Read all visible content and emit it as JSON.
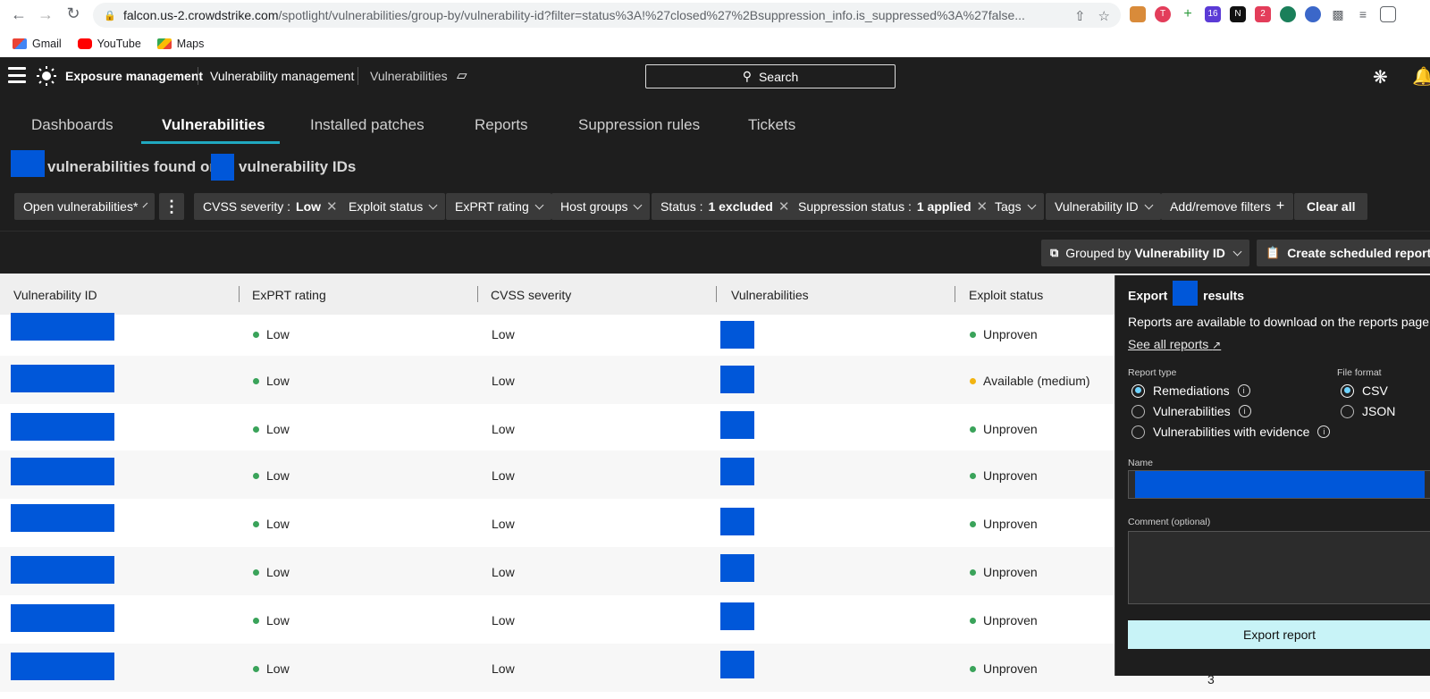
{
  "browser": {
    "url_host": "falcon.us-2.crowdstrike.com",
    "url_path": "/spotlight/vulnerabilities/group-by/vulnerability-id?filter=status%3A!%27closed%27%2Bsuppression_info.is_suppressed%3A%27false...",
    "bookmarks": [
      "Gmail",
      "YouTube",
      "Maps"
    ],
    "ext_badges": [
      "16",
      "2"
    ]
  },
  "header": {
    "product": "Exposure management",
    "section": "Vulnerability management",
    "page": "Vulnerabilities",
    "search_label": "Search"
  },
  "tabs": [
    "Dashboards",
    "Vulnerabilities",
    "Installed patches",
    "Reports",
    "Suppression rules",
    "Tickets"
  ],
  "active_tab": "Vulnerabilities",
  "summary": {
    "part1": "vulnerabilities found on",
    "part2": "vulnerability IDs"
  },
  "filters": {
    "open_vulns": "Open vulnerabilities*",
    "cvss_label": "CVSS severity :",
    "cvss_value": "Low",
    "exploit_status": "Exploit status",
    "exprt_rating": "ExPRT rating",
    "host_groups": "Host groups",
    "status_label": "Status :",
    "status_value": "1 excluded",
    "suppression_label": "Suppression status :",
    "suppression_value": "1 applied",
    "tags": "Tags",
    "vuln_id": "Vulnerability ID",
    "add_remove": "Add/remove filters",
    "clear_all": "Clear all"
  },
  "actions": {
    "grouped_by_prefix": "Grouped by",
    "grouped_by_value": "Vulnerability ID",
    "create_report": "Create scheduled report"
  },
  "table": {
    "columns": [
      "Vulnerability ID",
      "ExPRT rating",
      "CVSS severity",
      "Vulnerabilities",
      "Exploit status"
    ],
    "rows": [
      {
        "exprt": "Low",
        "cvss": "Low",
        "exploit": "Unproven",
        "exploit_level": "low"
      },
      {
        "exprt": "Low",
        "cvss": "Low",
        "exploit": "Available (medium)",
        "exploit_level": "medium"
      },
      {
        "exprt": "Low",
        "cvss": "Low",
        "exploit": "Unproven",
        "exploit_level": "low"
      },
      {
        "exprt": "Low",
        "cvss": "Low",
        "exploit": "Unproven",
        "exploit_level": "low"
      },
      {
        "exprt": "Low",
        "cvss": "Low",
        "exploit": "Unproven",
        "exploit_level": "low"
      },
      {
        "exprt": "Low",
        "cvss": "Low",
        "exploit": "Unproven",
        "exploit_level": "low"
      },
      {
        "exprt": "Low",
        "cvss": "Low",
        "exploit": "Unproven",
        "exploit_level": "low"
      },
      {
        "exprt": "Low",
        "cvss": "Low",
        "exploit": "Unproven",
        "exploit_level": "low"
      }
    ],
    "last_row_extra": "3"
  },
  "export_panel": {
    "title_prefix": "Export",
    "title_suffix": "results",
    "info": "Reports are available to download on the reports page fo",
    "see_all": "See all reports",
    "report_type_label": "Report type",
    "report_types": [
      "Remediations",
      "Vulnerabilities",
      "Vulnerabilities with evidence"
    ],
    "selected_report_type": "Remediations",
    "file_format_label": "File format",
    "file_formats": [
      "CSV",
      "JSON"
    ],
    "selected_format": "CSV",
    "name_label": "Name",
    "comment_label": "Comment (optional)",
    "export_button": "Export report"
  },
  "colors": {
    "accent": "#20a8c0",
    "redaction": "#0057d9",
    "status_low": "#3aa35a",
    "status_medium": "#f2b411",
    "export_button": "#c8f3f7"
  }
}
